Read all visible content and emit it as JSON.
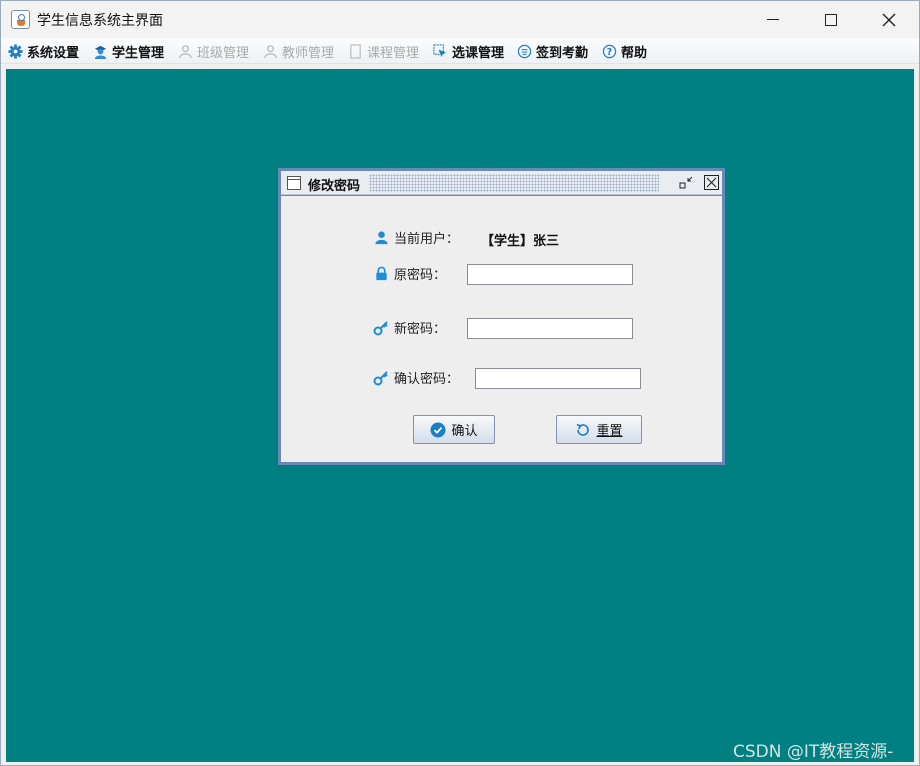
{
  "window": {
    "title": "学生信息系统主界面"
  },
  "menubar": {
    "items": [
      {
        "label": "系统设置",
        "icon": "gear-icon",
        "enabled": true
      },
      {
        "label": "学生管理",
        "icon": "student-icon",
        "enabled": true
      },
      {
        "label": "班级管理",
        "icon": "class-icon",
        "enabled": false
      },
      {
        "label": "教师管理",
        "icon": "teacher-icon",
        "enabled": false
      },
      {
        "label": "课程管理",
        "icon": "document-icon",
        "enabled": false
      },
      {
        "label": "选课管理",
        "icon": "cursor-select-icon",
        "enabled": true
      },
      {
        "label": "签到考勤",
        "icon": "attendance-icon",
        "enabled": true
      },
      {
        "label": "帮助",
        "icon": "help-icon",
        "enabled": true
      }
    ]
  },
  "dialog": {
    "title": "修改密码",
    "current_user_label": "当前用户：",
    "current_user_value": "【学生】张三",
    "old_password_label": "原密码：",
    "new_password_label": "新密码：",
    "confirm_password_label": "确认密码：",
    "confirm_button": "确认",
    "reset_button": "重置"
  },
  "watermark": "CSDN @IT教程资源-",
  "colors": {
    "desktop_background": "#008080",
    "accent_icon": "#1b8ed6",
    "frame_border": "#6a88b8"
  }
}
